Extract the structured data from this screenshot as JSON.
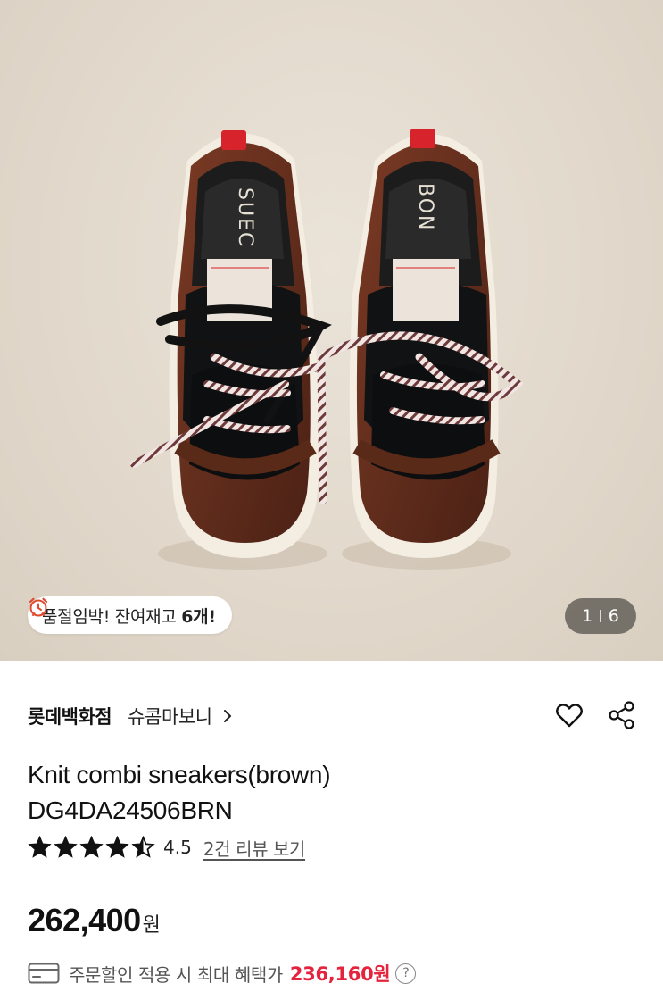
{
  "gallery": {
    "image_alt": "Knit combi sneakers (brown), top view",
    "stock_icon": "alarm-clock-icon",
    "stock_text_prefix": "품절임박! 잔여재고 ",
    "stock_count": "6개!",
    "pager_current": "1",
    "pager_total": "6",
    "shoe_logo_left": "SUEC",
    "shoe_logo_right": "BON"
  },
  "product": {
    "store": "롯데백화점",
    "brand": "슈콤마보니",
    "title_line1": "Knit combi sneakers(brown)",
    "title_line2": "DG4DA24506BRN",
    "rating_value": 4.5,
    "rating": "4.5",
    "review_link": "2건 리뷰 보기",
    "price": "262,400",
    "price_unit": "원",
    "benefit_label": "주문할인 적용 시 최대 혜택가",
    "benefit_price": "236,160원",
    "help_symbol": "?"
  },
  "colors": {
    "accent_red": "#e5233d",
    "background": "#ffffff",
    "photo_bg": "#e2d9cc"
  }
}
